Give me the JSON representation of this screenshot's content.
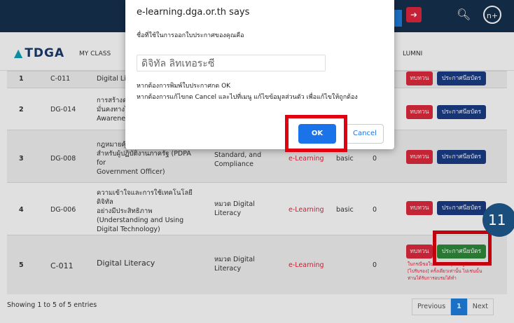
{
  "topbar": {
    "user_label": "n+"
  },
  "nav": {
    "logo": "TDGA",
    "menu_myclass": "MY CLASS",
    "menu_alumni": "LUMNI"
  },
  "table": {
    "rows": [
      {
        "no": "1",
        "code": "C-011",
        "title": "Digital Li",
        "category": "",
        "type": "",
        "level": "",
        "hours": "",
        "btn_red": "ทบทวน",
        "btn_cert": "ประกาศนียบัตร"
      },
      {
        "no": "2",
        "code": "DG-014",
        "title": "การสร้างค\nมั่นคงทางไ\nAwarenes",
        "category": "",
        "type": "",
        "level": "",
        "hours": "",
        "btn_red": "ทบทวน",
        "btn_cert": "ประกาศนียบัตร"
      },
      {
        "no": "3",
        "code": "DG-008",
        "title": "กฎหมายคุ้ม\nสำหรับผู้ปฏิบัติงานภาครัฐ (PDPA for\nGovernment Officer)",
        "category": "Governance,\nStandard, and\nCompliance",
        "type": "e-Learning",
        "level": "basic",
        "hours": "0",
        "btn_red": "ทบทวน",
        "btn_cert": "ประกาศนียบัตร"
      },
      {
        "no": "4",
        "code": "DG-006",
        "title": "ความเข้าใจและการใช้เทคโนโลยีดิจิทัล\nอย่างมีประสิทธิภาพ\n(Understanding and Using\nDigital Technology)",
        "category": "หมวด Digital\nLiteracy",
        "type": "e-Learning",
        "level": "basic",
        "hours": "0",
        "btn_red": "ทบทวน",
        "btn_cert": "ประกาศนียบัตร"
      },
      {
        "no": "5",
        "code": "C-011",
        "title": "Digital Literacy",
        "category": "หมวด Digital\nLiteracy",
        "type": "e-Learning",
        "level": "",
        "hours": "0",
        "btn_red": "ทบทวน",
        "btn_cert": "ประกาศนียบัตร",
        "note": "ในกรณีขอใบ...ของ กรุณาอยู่ทับ\n[ไปรับรอง] ครั้งเดียวเท่านั้น ไม่เช่นนั้น\nท่านได้รับการอบรมได้ทำ"
      }
    ],
    "footer": "Showing 1 to 5 of 5 entries",
    "pager": {
      "prev": "Previous",
      "page": "1",
      "next": "Next"
    }
  },
  "dialog": {
    "title": "e-learning.dga.or.th says",
    "message": "ชื่อที่ใช้ในการออกใบประกาศของคุณคือ",
    "input_value": "ดิจิทัล ลิทเทอระซี",
    "line1": "หากต้องการพิมพ์ใบประกาศกด OK",
    "line2": "หากต้องการแก้ไขกด Cancel และไปที่เมนู แก้ไขข้อมูลส่วนตัว เพื่อแก้ไขให้ถูกต้อง",
    "ok": "OK",
    "cancel": "Cancel"
  },
  "step_badge": "11",
  "colors": {
    "highlight": "#e0000f",
    "primary_blue": "#1a73e8",
    "review_red": "#df2a3e",
    "cert_navy": "#1b3d85",
    "cert_green": "#2e8b3a"
  }
}
